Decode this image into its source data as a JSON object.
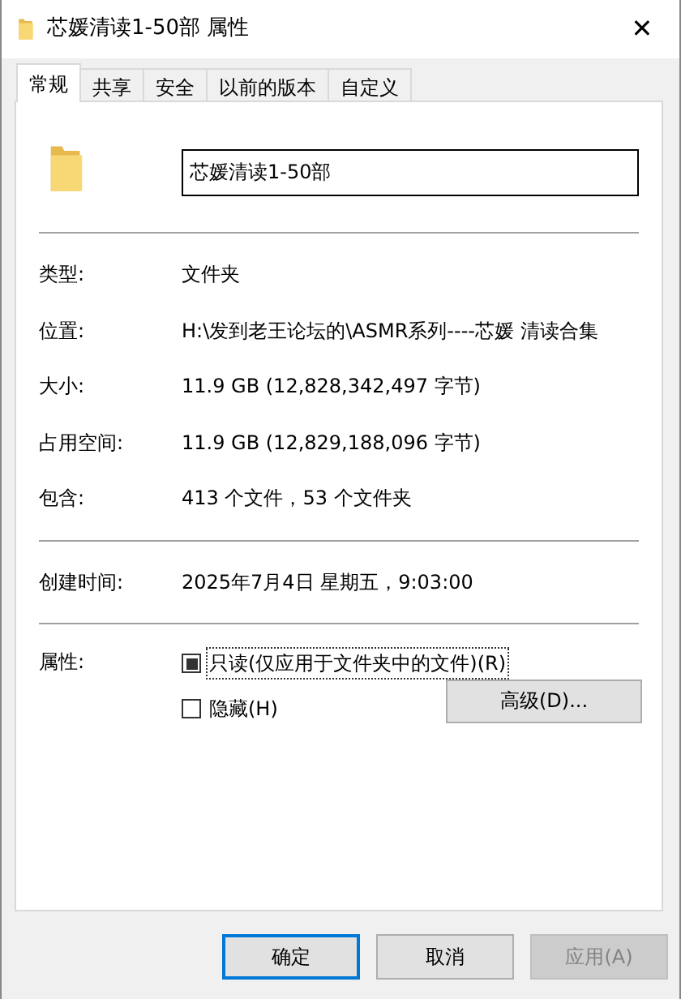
{
  "window": {
    "title": "芯媛清读1-50部 属性",
    "close": "✕"
  },
  "tabs": [
    {
      "label": "常规",
      "selected": true
    },
    {
      "label": "共享",
      "selected": false
    },
    {
      "label": "安全",
      "selected": false
    },
    {
      "label": "以前的版本",
      "selected": false
    },
    {
      "label": "自定义",
      "selected": false
    }
  ],
  "name_field": {
    "value": "芯媛清读1-50部"
  },
  "info_groups": [
    [
      {
        "label": "类型:",
        "value": "文件夹"
      },
      {
        "label": "位置:",
        "value": "H:\\发到老王论坛的\\ASMR系列----芯媛 清读合集"
      },
      {
        "label": "大小:",
        "value": "11.9 GB (12,828,342,497 字节)"
      },
      {
        "label": "占用空间:",
        "value": "11.9 GB (12,829,188,096 字节)"
      },
      {
        "label": "包含:",
        "value": "413 个文件，53 个文件夹"
      }
    ],
    [
      {
        "label": "创建时间:",
        "value": "2025年7月4日 星期五，9:03:00"
      }
    ]
  ],
  "attributes": {
    "label": "属性:",
    "checkboxes": [
      {
        "label": "只读(仅应用于文件夹中的文件)(R)",
        "checked": false,
        "indeterminate": true,
        "focused": true
      },
      {
        "label": "隐藏(H)",
        "checked": false,
        "indeterminate": false,
        "focused": false
      }
    ],
    "advanced_button": "高级(D)..."
  },
  "buttons": [
    {
      "label": "确定",
      "default": true,
      "disabled": false
    },
    {
      "label": "取消",
      "default": false,
      "disabled": false
    },
    {
      "label": "应用(A)",
      "default": false,
      "disabled": true
    }
  ]
}
